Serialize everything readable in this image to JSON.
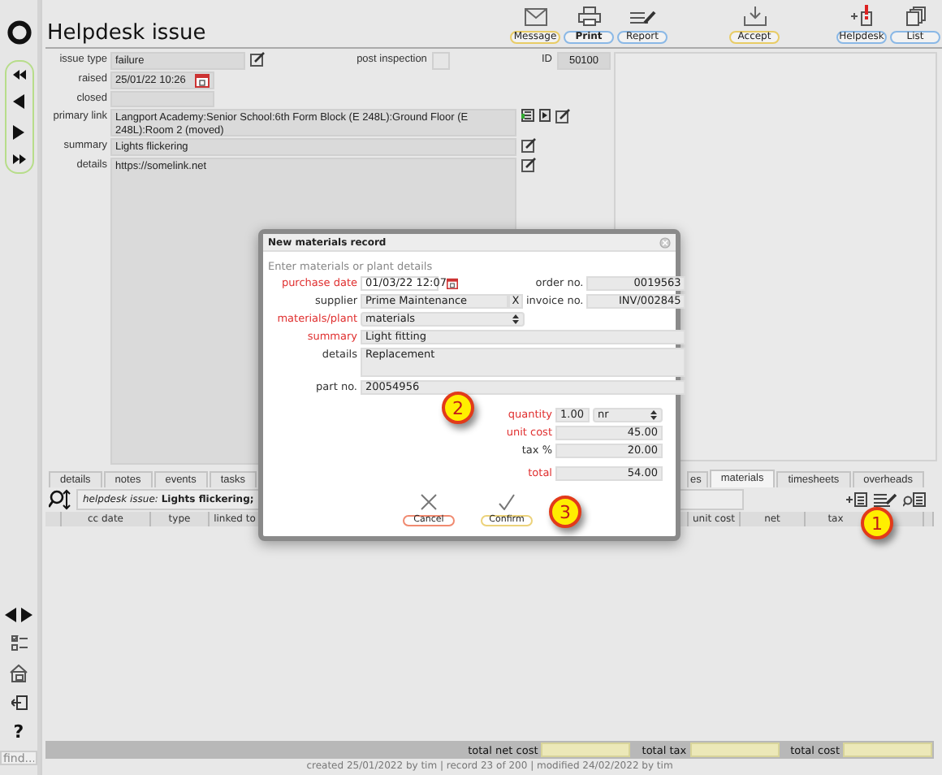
{
  "sidebar": {
    "help": "?",
    "find": {
      "placeholder": "find..."
    }
  },
  "title": "Helpdesk issue",
  "toolbar": [
    {
      "label": "Message",
      "kind": "message",
      "color": "#e8cc66",
      "default": false
    },
    {
      "label": "Print",
      "kind": "print",
      "color": "#8ab8e6",
      "default": true
    },
    {
      "label": "Report",
      "kind": "report",
      "color": "#8ab8e6",
      "default": false
    },
    {
      "label": "Accept",
      "kind": "accept",
      "color": "#e8cc66",
      "default": false
    },
    {
      "label": "Helpdesk",
      "kind": "helpdesk",
      "color": "#8ab8e6",
      "default": false
    },
    {
      "label": "List",
      "kind": "list",
      "color": "#8ab8e6",
      "default": false
    }
  ],
  "form": {
    "issue_type": {
      "label": "issue type",
      "value": "failure"
    },
    "post_inspection": {
      "label": "post inspection",
      "checked": false
    },
    "id": {
      "label": "ID",
      "value": "50100"
    },
    "raised": {
      "label": "raised",
      "value": "25/01/22 10:26"
    },
    "closed": {
      "label": "closed"
    },
    "primary_link": {
      "label": "primary link",
      "value": "Langport Academy:Senior School:6th Form Block (E 248L):Ground Floor (E 248L):Room 2 (moved)"
    },
    "summary": {
      "label": "summary",
      "value": "Lights flickering"
    },
    "details": {
      "label": "details",
      "value": "https://somelink.net"
    }
  },
  "tabs": [
    {
      "label": "details",
      "selected": false
    },
    {
      "label": "notes",
      "selected": false
    },
    {
      "label": "events",
      "selected": false
    },
    {
      "label": "tasks",
      "selected": false
    },
    {
      "label": "es",
      "selected": false
    },
    {
      "label": "materials",
      "selected": true
    },
    {
      "label": "timesheets",
      "selected": false
    },
    {
      "label": "overheads",
      "selected": false
    }
  ],
  "info": "*helpdesk issue:* **Lights flickering;**",
  "table": {
    "columns": [
      "cc date",
      "type",
      "linked to",
      "unit cost",
      "net",
      "tax"
    ]
  },
  "totals": [
    {
      "label": "total net cost"
    },
    {
      "label": "total tax"
    },
    {
      "label": "total cost"
    }
  ],
  "footer": "created 25/01/2022 by tim | record 23 of 200 | modified 24/02/2022 by tim",
  "dialog": {
    "title": "New materials record",
    "subtitle": "Enter materials or plant details",
    "purchase_date": {
      "label": "purchase date",
      "value": "01/03/22 12:07",
      "required": true
    },
    "order_no": {
      "label": "order no.",
      "value": "0019563",
      "required": false
    },
    "supplier": {
      "label": "supplier",
      "value": "Prime Maintenance",
      "clear": "X",
      "required": false
    },
    "invoice_no": {
      "label": "invoice no.",
      "value": "INV/002845",
      "required": false
    },
    "materials_plant": {
      "label": "materials/plant",
      "value": "materials",
      "required": true
    },
    "summary": {
      "label": "summary",
      "value": "Light fitting",
      "required": true
    },
    "details": {
      "label": "details",
      "value": "Replacement",
      "required": false
    },
    "part_no": {
      "label": "part no.",
      "value": "20054956",
      "required": false
    },
    "quantity": {
      "label": "quantity",
      "value": "1.00",
      "unit": "nr",
      "required": true
    },
    "unit_cost": {
      "label": "unit cost",
      "value": "45.00",
      "required": true
    },
    "tax": {
      "label": "tax %",
      "value": "20.00",
      "required": false
    },
    "total": {
      "label": "total",
      "value": "54.00",
      "required": true
    },
    "buttons": [
      {
        "label": "Cancel",
        "kind": "cancel"
      },
      {
        "label": "Confirm",
        "kind": "confirm"
      }
    ]
  },
  "callouts": [
    {
      "label": "1"
    },
    {
      "label": "2"
    },
    {
      "label": "3"
    }
  ]
}
